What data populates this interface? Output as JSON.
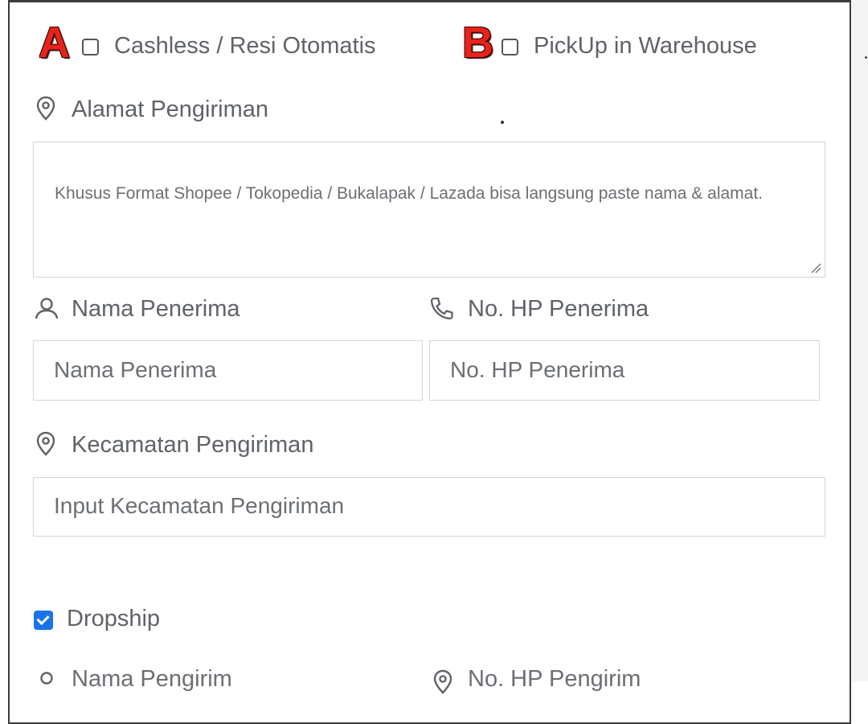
{
  "markers": {
    "a": "A",
    "b": "B"
  },
  "options": {
    "cashless_label": "Cashless / Resi Otomatis",
    "cashless_checked": false,
    "pickup_label": "PickUp in Warehouse",
    "pickup_checked": false
  },
  "address": {
    "label": "Alamat Pengiriman",
    "icon": "location-pin-icon",
    "placeholder": "Khusus Format Shopee / Tokopedia / Bukalapak / Lazada bisa langsung paste nama & alamat."
  },
  "recipient": {
    "name_label": "Nama Penerima",
    "name_icon": "user-icon",
    "name_placeholder": "Nama Penerima",
    "phone_label": "No. HP Penerima",
    "phone_icon": "phone-icon",
    "phone_placeholder": "No. HP Penerima"
  },
  "district": {
    "label": "Kecamatan Pengiriman",
    "icon": "location-pin-icon",
    "placeholder": "Input Kecamatan Pengiriman"
  },
  "dropship": {
    "label": "Dropship",
    "checked": true
  },
  "sender": {
    "name_label": "Nama Pengirim",
    "phone_label": "No. HP Pengirim"
  },
  "colors": {
    "accent": "#1a73e8",
    "marker": "#e8231a",
    "border": "#cfd6dc",
    "text": "#5f6368"
  }
}
